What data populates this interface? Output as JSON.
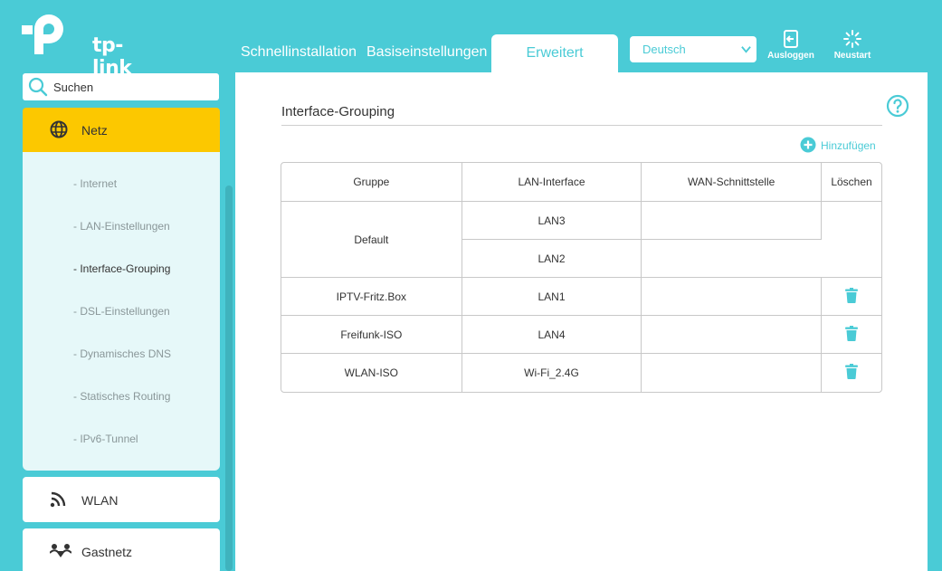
{
  "brand": {
    "logo_text": "tp-link",
    "accent_color": "#4acbd6",
    "active_color": "#fcc800"
  },
  "header": {
    "tabs": [
      {
        "label": "Schnellinstallation"
      },
      {
        "label": "Basiseinstellungen"
      },
      {
        "label": "Erweitert",
        "active": true
      }
    ],
    "language": {
      "selected": "Deutsch"
    },
    "logout_label": "Ausloggen",
    "reboot_label": "Neustart"
  },
  "sidebar": {
    "search_placeholder": "Suchen",
    "active_section": {
      "label": "Netz",
      "icon": "globe-icon"
    },
    "sub_items": [
      {
        "label": "- Internet"
      },
      {
        "label": "- LAN-Einstellungen"
      },
      {
        "label": "- Interface-Grouping",
        "active": true
      },
      {
        "label": "- DSL-Einstellungen"
      },
      {
        "label": "- Dynamisches DNS"
      },
      {
        "label": "- Statisches Routing"
      },
      {
        "label": "- IPv6-Tunnel"
      }
    ],
    "sections": [
      {
        "label": "WLAN",
        "icon": "wifi-icon"
      },
      {
        "label": "Gastnetz",
        "icon": "guest-network-icon"
      }
    ]
  },
  "main": {
    "title": "Interface-Grouping",
    "add_label": "Hinzufügen",
    "table": {
      "headers": [
        "Gruppe",
        "LAN-Interface",
        "WAN-Schnittstelle",
        "Löschen"
      ],
      "rows": [
        {
          "group": "Default",
          "lan": [
            "LAN3",
            "LAN2"
          ],
          "wan": "",
          "deletable": false
        },
        {
          "group": "IPTV-Fritz.Box",
          "lan": [
            "LAN1"
          ],
          "wan": "",
          "deletable": true
        },
        {
          "group": "Freifunk-ISO",
          "lan": [
            "LAN4"
          ],
          "wan": "",
          "deletable": true
        },
        {
          "group": "WLAN-ISO",
          "lan": [
            "Wi-Fi_2.4G"
          ],
          "wan": "",
          "deletable": true
        }
      ]
    }
  }
}
